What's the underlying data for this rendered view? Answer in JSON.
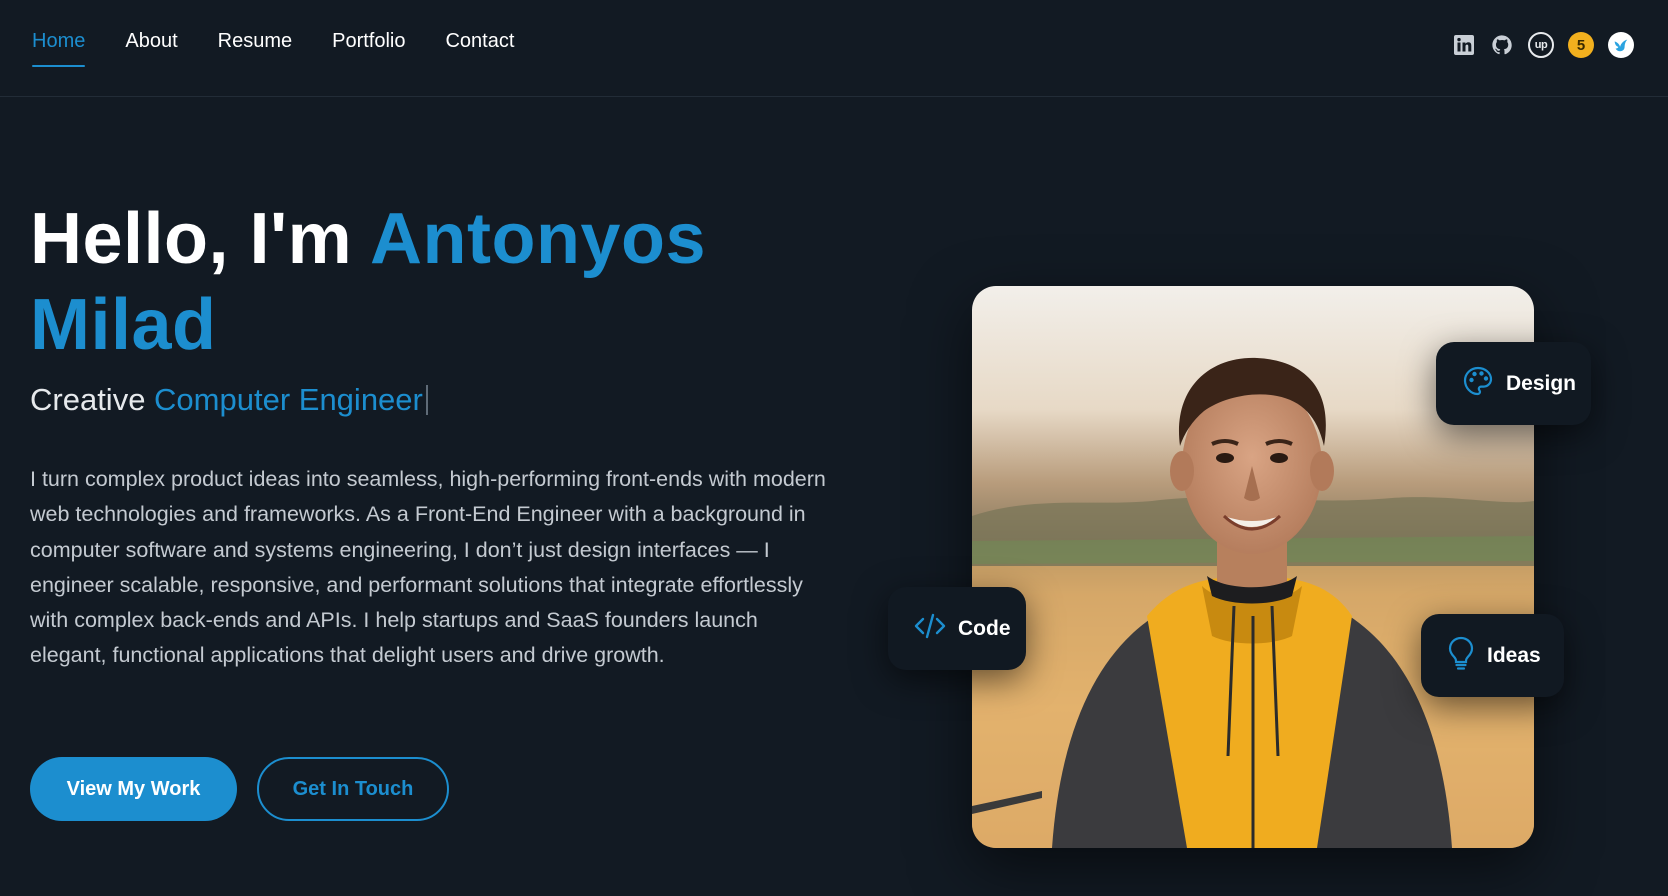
{
  "nav": {
    "links": [
      {
        "label": "Home",
        "active": true
      },
      {
        "label": "About"
      },
      {
        "label": "Resume"
      },
      {
        "label": "Portfolio"
      },
      {
        "label": "Contact"
      }
    ],
    "social_icons": [
      "linkedin-icon",
      "github-icon",
      "upwork-icon",
      "five-badge-icon",
      "bird-icon"
    ],
    "five_badge_text": "5",
    "upwork_text": "up"
  },
  "hero": {
    "greeting": "Hello, I'm ",
    "name": "Antonyos Milad",
    "subtitle_prefix": "Creative ",
    "subtitle_role": "Computer Engineer",
    "description": "I turn complex product ideas into seamless, high-performing front-ends with modern web technologies and frameworks. As a Front-End Engineer with a background in computer software and systems engineering, I don’t just design interfaces — I engineer scalable, responsive, and performant solutions that integrate effortlessly with complex back-ends and APIs. I help startups and SaaS founders launch elegant, functional applications that delight users and drive growth.",
    "primary_button": "View My Work",
    "secondary_button": "Get In Touch"
  },
  "badges": {
    "design": "Design",
    "code": "Code",
    "ideas": "Ideas"
  },
  "colors": {
    "accent": "#1c8ecf",
    "background": "#121a23",
    "badge_bg": "#111922"
  }
}
